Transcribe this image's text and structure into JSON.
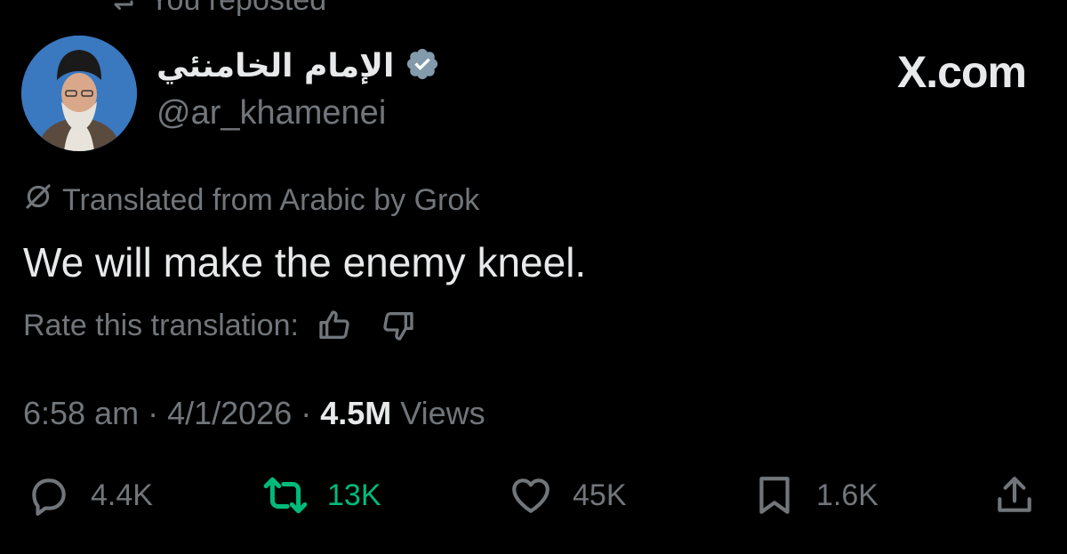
{
  "repost_banner": "You reposted",
  "author": {
    "display_name": "الإمام الخامنئي",
    "handle": "@ar_khamenei"
  },
  "brand": "X.com",
  "translation": {
    "notice": "Translated from Arabic by Grok",
    "rate_label": "Rate this translation:"
  },
  "tweet": {
    "text": "We will make the enemy kneel."
  },
  "meta": {
    "time": "6:58 am",
    "sep1": " · ",
    "date": "4/1/2026",
    "sep2": " · ",
    "views_count": "4.5M",
    "views_label": " Views"
  },
  "actions": {
    "replies": "4.4K",
    "reposts": "13K",
    "likes": "45K",
    "bookmarks": "1.6K"
  },
  "colors": {
    "background": "#000000",
    "primary_text": "#e7e9ea",
    "secondary_text": "#71767b",
    "repost_active": "#00ba7c",
    "verified_badge": "#829aab"
  },
  "icons": {
    "repost_banner": "repost-icon",
    "verified": "verified-badge-icon",
    "translate": "grok-icon",
    "rate_up": "thumbs-up-icon",
    "rate_down": "thumbs-down-icon",
    "reply": "reply-icon",
    "repost": "repost-icon",
    "like": "heart-icon",
    "bookmark": "bookmark-icon",
    "share": "share-icon"
  }
}
